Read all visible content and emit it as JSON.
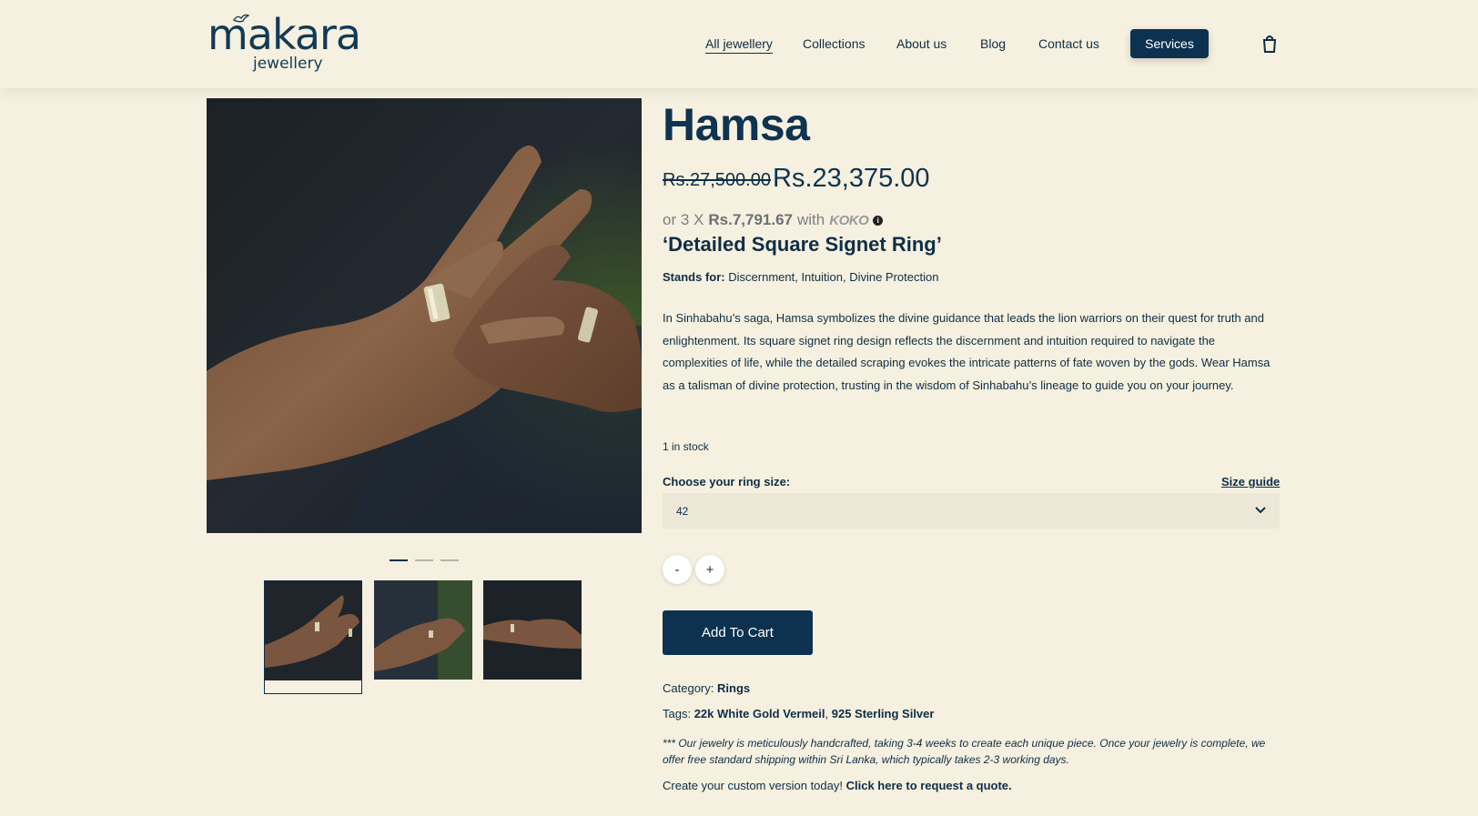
{
  "header": {
    "logo_main": "makara",
    "logo_sub": "jewellery",
    "nav": [
      "All jewellery",
      "Collections",
      "About us",
      "Blog",
      "Contact us"
    ],
    "services_label": "Services",
    "cart_icon": "shopping-bag-icon"
  },
  "gallery": {
    "slide_count": 3,
    "active_slide": 1,
    "thumbnail_count": 3
  },
  "product": {
    "title": "Hamsa",
    "old_price": "Rs.27,500.00",
    "new_price": "Rs.23,375.00",
    "koko_prefix": "or 3 X",
    "koko_amount": "Rs.7,791.67",
    "koko_with": "with",
    "koko_logo": "KOKO",
    "subtitle": "‘Detailed Square Signet Ring’",
    "stands_label": "Stands for:",
    "stands_value": "Discernment, Intuition, Divine Protection",
    "description": "In Sinhabahu’s saga, Hamsa symbolizes the divine guidance that leads the lion warriors on their quest for truth and enlightenment. Its square signet ring design reflects the discernment and intuition required to navigate the complexities of life, while the detailed scraping evokes the intricate patterns of fate woven by the gods. Wear Hamsa as a talisman of divine protection, trusting in the wisdom of Sinhabahu’s lineage to guide you on your journey.",
    "stock": "1 in stock",
    "size_label": "Choose your ring size:",
    "size_guide": "Size guide",
    "size_value": "42",
    "qty_minus": "-",
    "qty_plus": "+",
    "add_to_cart": "Add To Cart",
    "category_label": "Category:",
    "category_value": "Rings",
    "tags_label": "Tags:",
    "tag_1": "22k White Gold Vermeil",
    "tag_sep": ",",
    "tag_2": "925 Sterling Silver",
    "note": "*** Our jewelry is meticulously handcrafted, taking 3-4 weeks to create each unique piece. Once your jewelry is complete, we offer free standard shipping within Sri Lanka, which typically takes 2-3 working days.",
    "custom_text": "Create your custom version today!",
    "custom_link": "Click here to request a quote."
  },
  "colors": {
    "background": "#f5f0df",
    "brand_navy": "#0d3250",
    "select_bg": "#ede7d7"
  }
}
